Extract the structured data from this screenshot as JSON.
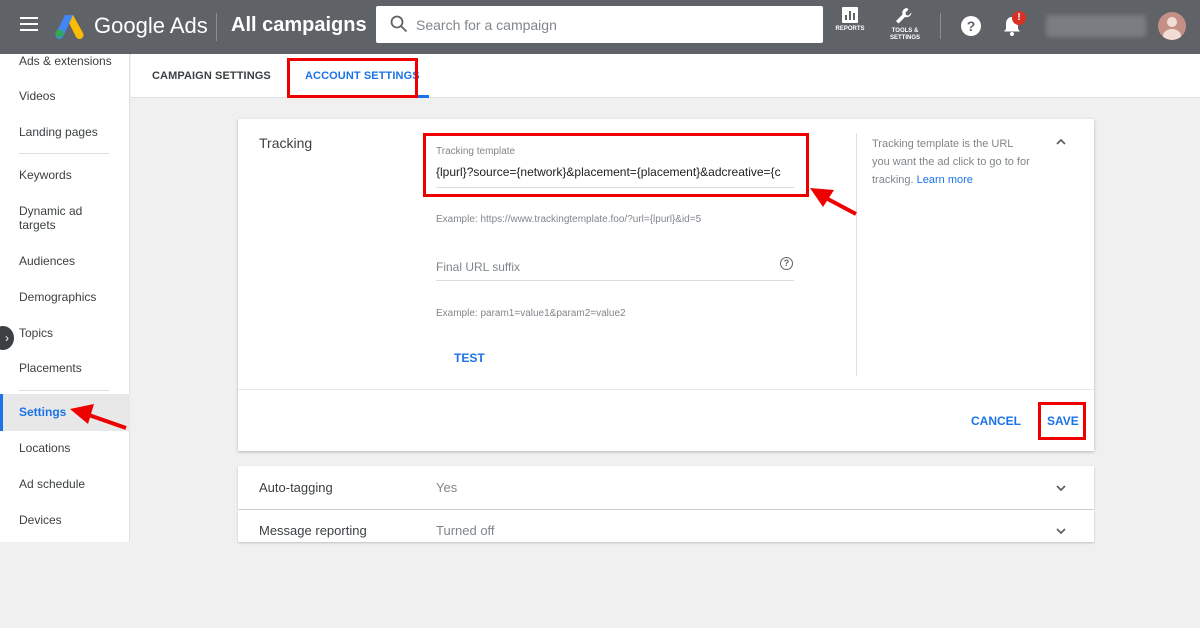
{
  "topbar": {
    "product_name": "Google Ads",
    "page_title": "All campaigns",
    "search_placeholder": "Search for a campaign",
    "reports_label": "REPORTS",
    "tools_label_1": "TOOLS &",
    "tools_label_2": "SETTINGS",
    "help_glyph": "?",
    "notification_badge": "!"
  },
  "sidebar": {
    "items": [
      "Ads & extensions",
      "Videos",
      "Landing pages",
      "Keywords",
      "Dynamic ad targets",
      "Audiences",
      "Demographics",
      "Topics",
      "Placements",
      "Settings",
      "Locations",
      "Ad schedule",
      "Devices"
    ],
    "active_item": "Settings"
  },
  "tabs": [
    "CAMPAIGN SETTINGS",
    "ACCOUNT SETTINGS"
  ],
  "tracking": {
    "section_label": "Tracking",
    "template_label": "Tracking template",
    "template_value": "{lpurl}?source={network}&placement={placement}&adcreative={c",
    "template_example": "Example: https://www.trackingtemplate.foo/?url={lpurl}&id=5",
    "suffix_placeholder": "Final URL suffix",
    "suffix_example": "Example: param1=value1&param2=value2",
    "test_label": "TEST",
    "help_text": "Tracking template is the URL you want the ad click to go to for tracking.",
    "learn_more": "Learn more",
    "cancel_label": "CANCEL",
    "save_label": "SAVE"
  },
  "rows": [
    {
      "label": "Auto-tagging",
      "value": "Yes"
    },
    {
      "label": "Message reporting",
      "value": "Turned off"
    }
  ],
  "colors": {
    "topbar": "#5f6368",
    "accent": "#1a73e8",
    "highlight": "#e00000"
  }
}
